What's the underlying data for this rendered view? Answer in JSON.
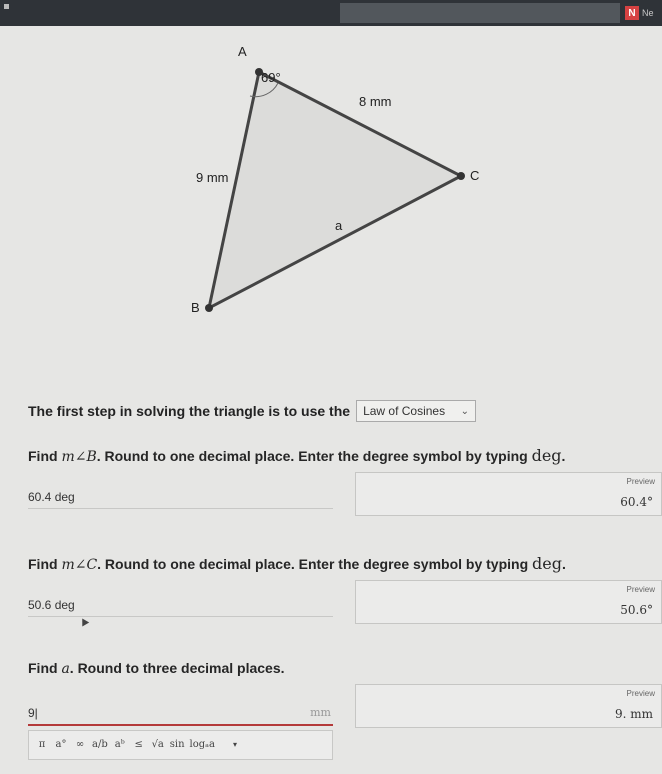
{
  "browser": {
    "next_label": "Ne"
  },
  "figure": {
    "vertex_a": "A",
    "vertex_b": "B",
    "vertex_c": "C",
    "angle_a": "69°",
    "side_ac": "8 mm",
    "side_ab": "9 mm",
    "side_bc": "a",
    "fill_color": "#dcdcda",
    "stroke_color": "#444444",
    "vertex_color": "#333333"
  },
  "step": {
    "prefix": "The first step in solving the triangle is to use the",
    "selected": "Law of Cosines"
  },
  "questions": [
    {
      "pre": "Find ",
      "math": "m∠B",
      "post": ". Round to one decimal place. Enter the degree symbol by typing ",
      "deg": "deg",
      "end": ".",
      "answer": "60.4 deg",
      "preview_label": "Preview",
      "preview_value": "60.4°"
    },
    {
      "pre": "Find ",
      "math": "m∠C",
      "post": ". Round to one decimal place. Enter the degree symbol by typing ",
      "deg": "deg",
      "end": ".",
      "answer": "50.6 deg",
      "preview_label": "Preview",
      "preview_value": "50.6°"
    },
    {
      "pre": "Find ",
      "math": "a",
      "post": ". Round to three decimal places.",
      "answer": "9|",
      "unit_hint": "mm",
      "preview_label": "Preview",
      "preview_value": "9. mm"
    }
  ],
  "toolbar": {
    "buttons": [
      "π",
      "a°",
      "∞",
      "a/b",
      "aᵇ",
      "≤",
      "√a",
      "sin",
      "logₐa"
    ],
    "dropdown": "▾"
  },
  "accent_color": "#b43a3a"
}
